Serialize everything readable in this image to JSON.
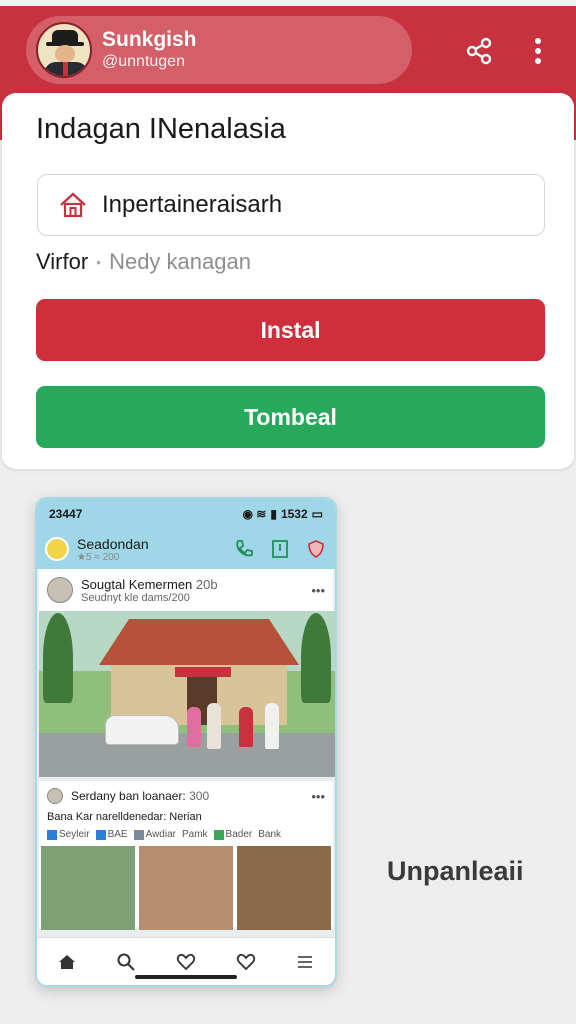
{
  "header": {
    "profile_name": "Sunkgish",
    "profile_handle": "@unntugen",
    "share_icon": "share-icon",
    "more_icon": "more-vertical-icon",
    "color": "#c8323e"
  },
  "card": {
    "title": "Indagan INenalasia",
    "search_value": "Inpertaineraisarh",
    "vendor": "Virfor",
    "subtitle": "Nedy kanagan",
    "install_label": "Instal",
    "secondary_label": "Tombeal",
    "install_color": "#cf2f3c",
    "secondary_color": "#26a95a"
  },
  "preview": {
    "label": "Unpanleaii",
    "status_time": "23447",
    "status_right": "1532",
    "app_name": "Seadondan",
    "app_sub": "★5 ≈ 200",
    "post1_name": "Sougtal Kemermen",
    "post1_time": "20b",
    "post1_sub": "Seudnyt kle dams/200",
    "post2_name": "Serdany ban loanaer:",
    "post2_time": "300",
    "post2_caption": "Bana Kar narelldenedar: Nerian",
    "tags": [
      "Seyleir",
      "BAE",
      "Awdiar",
      "Pamk",
      "Bader",
      "Bank"
    ],
    "nav_icons": [
      "home-icon",
      "search-icon",
      "heart-icon",
      "heart-outline-icon",
      "menu-icon"
    ]
  }
}
